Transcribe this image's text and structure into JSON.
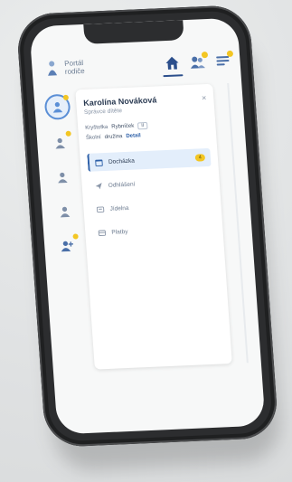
{
  "header": {
    "brand_line1": "Portál",
    "brand_line2": "rodiče",
    "icons": [
      "home-icon",
      "people-icon",
      "messages-icon"
    ],
    "accent": "#2c4f8c",
    "notification_color": "#f3c623"
  },
  "rail": {
    "children": [
      {
        "name": "child-1",
        "selected": true,
        "notification": true
      },
      {
        "name": "child-2",
        "selected": false,
        "notification": true
      },
      {
        "name": "child-3",
        "selected": false,
        "notification": false
      },
      {
        "name": "child-4",
        "selected": false,
        "notification": false
      },
      {
        "name": "add-child",
        "selected": false,
        "notification": true
      }
    ]
  },
  "panel": {
    "name": "Karolína Nováková",
    "role": "Správce dítěte",
    "close": "×",
    "meta1_label": "Kryštofka",
    "meta1_value": "Rybníček",
    "meta1_chip": "II",
    "meta2_label": "Školní",
    "meta2_value": "družina",
    "meta2_link": "Detail",
    "menu": [
      {
        "label": "Docházka",
        "icon": "calendar-icon",
        "active": true,
        "badge": "4"
      },
      {
        "label": "Odhlášení",
        "icon": "send-icon",
        "active": false,
        "badge": ""
      },
      {
        "label": "Jídelna",
        "icon": "food-icon",
        "active": false,
        "badge": ""
      },
      {
        "label": "Platby",
        "icon": "payment-icon",
        "active": false,
        "badge": ""
      }
    ]
  }
}
